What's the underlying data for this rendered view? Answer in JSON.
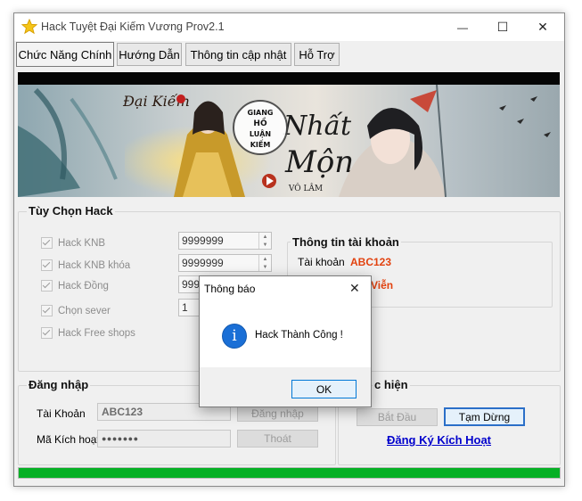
{
  "window": {
    "title": "Hack Tuyệt Đại Kiếm Vương  Prov2.1",
    "controls": {
      "minimize": "—",
      "maximize": "☐",
      "close": "✕"
    }
  },
  "tabs": [
    {
      "label": "Chức Năng Chính",
      "active": true
    },
    {
      "label": "Hướng Dẫn",
      "active": false
    },
    {
      "label": "Thông tin cập nhật",
      "active": false
    },
    {
      "label": "Hỗ Trợ",
      "active": false
    }
  ],
  "banner": {
    "logo_text": "Đại Kiếm",
    "badge_lines": [
      "GIANG",
      "HỒ",
      "LUẬN",
      "KIẾM"
    ],
    "calligraphy": "Nhất Mộng",
    "sub": "VÔ LÂM"
  },
  "hack_options": {
    "title": "Tùy Chọn Hack",
    "items": [
      {
        "label": "Hack KNB",
        "checked": true,
        "value": "9999999"
      },
      {
        "label": "Hack KNB khóa",
        "checked": true,
        "value": "9999999"
      },
      {
        "label": "Hack Đồng",
        "checked": true,
        "value": "999"
      },
      {
        "label": "Chọn sever",
        "checked": true,
        "value": "1"
      },
      {
        "label": "Hack Free shops",
        "checked": true
      }
    ]
  },
  "account_info": {
    "title": "Thông tin tài khoản",
    "account_label": "Tài khoản",
    "account_value": "ABC123",
    "rank_value": "Viễn"
  },
  "login": {
    "title": "Đăng nhập",
    "account_label": "Tài Khoản",
    "account_value": "ABC123",
    "code_label": "Mã Kích hoạt",
    "code_value": "●●●●●●●",
    "login_button": "Đăng nhập",
    "logout_button": "Thoát"
  },
  "execute": {
    "title": "c hiện",
    "start_button": "Bắt Đầu",
    "pause_button": "Tạm Dừng",
    "register_link": "Đăng Ký Kích Hoạt"
  },
  "progress": {
    "value": 1.0,
    "color": "#06b025"
  },
  "dialog": {
    "title": "Thông báo",
    "close_glyph": "✕",
    "icon": "info-icon",
    "icon_glyph": "i",
    "message": "Hack Thành Công !",
    "ok_button": "OK"
  },
  "colors": {
    "accent_red": "#e2420f",
    "link_blue": "#0000cc",
    "progress_green": "#06b025",
    "info_blue": "#1a6fd6"
  }
}
